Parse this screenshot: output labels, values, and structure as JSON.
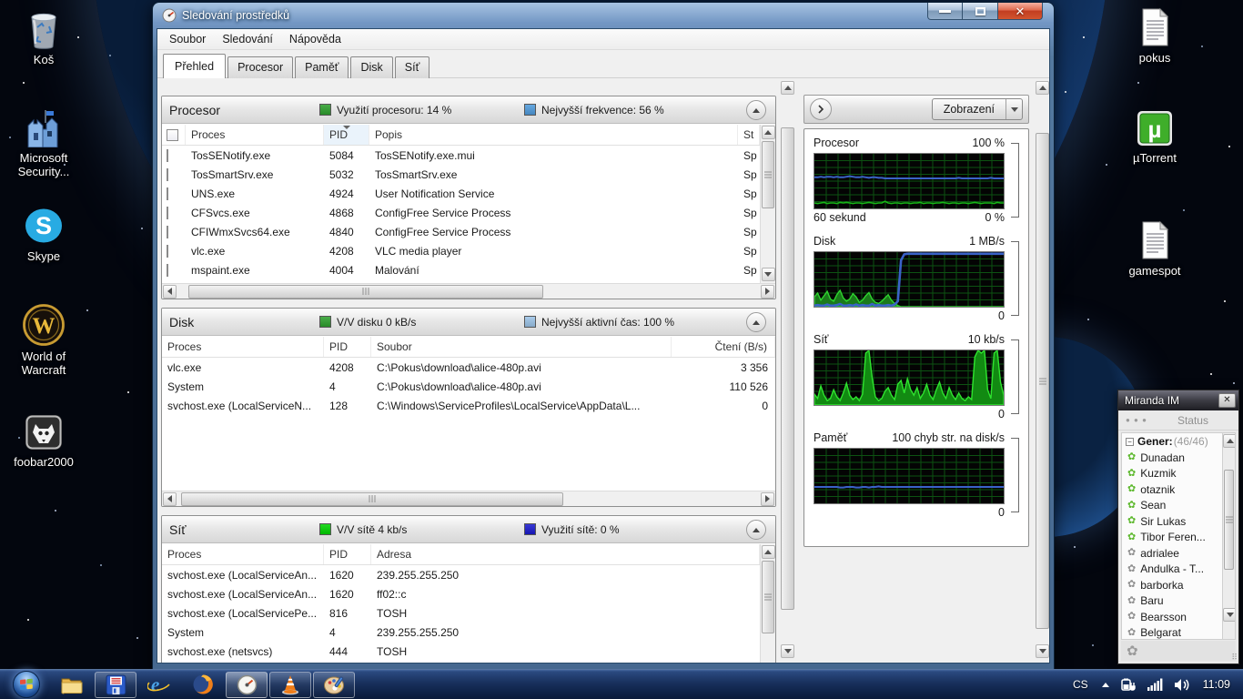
{
  "window": {
    "title": "Sledování prostředků",
    "menu": [
      "Soubor",
      "Sledování",
      "Nápověda"
    ],
    "tabs": [
      "Přehled",
      "Procesor",
      "Paměť",
      "Disk",
      "Síť"
    ],
    "active_tab": "Přehled"
  },
  "sections": [
    {
      "id": "cpu",
      "title": "Procesor",
      "legend1": {
        "label": "Využití procesoru: 14 %",
        "color": "#2da02d"
      },
      "legend2": {
        "label": "Nejvyšší frekvence: 56 %",
        "color": "#4f9bdc"
      },
      "checkbox": true,
      "columns": [
        "Proces",
        "PID",
        "Popis",
        "St"
      ],
      "sorted_column": "PID",
      "rows": [
        [
          "TosSENotify.exe",
          "5084",
          "TosSENotify.exe.mui",
          "Sp"
        ],
        [
          "TosSmartSrv.exe",
          "5032",
          "TosSmartSrv.exe",
          "Sp"
        ],
        [
          "UNS.exe",
          "4924",
          "User Notification Service",
          "Sp"
        ],
        [
          "CFSvcs.exe",
          "4868",
          "ConfigFree Service Process",
          "Sp"
        ],
        [
          "CFIWmxSvcs64.exe",
          "4840",
          "ConfigFree Service Process",
          "Sp"
        ],
        [
          "vlc.exe",
          "4208",
          "VLC media player",
          "Sp"
        ],
        [
          "mspaint.exe",
          "4004",
          "Malování",
          "Sp"
        ]
      ]
    },
    {
      "id": "disk",
      "title": "Disk",
      "legend1": {
        "label": "V/V disku 0 kB/s",
        "color": "#2da02d"
      },
      "legend2": {
        "label": "Nejvyšší aktivní čas: 100 %",
        "color": "#9cc4e8"
      },
      "checkbox": false,
      "columns": [
        "Proces",
        "PID",
        "Soubor",
        "Čtení (B/s)"
      ],
      "rows": [
        [
          "vlc.exe",
          "4208",
          "C:\\Pokus\\download\\alice-480p.avi",
          "3 356"
        ],
        [
          "System",
          "4",
          "C:\\Pokus\\download\\alice-480p.avi",
          "110 526"
        ],
        [
          "svchost.exe (LocalServiceN...",
          "128",
          "C:\\Windows\\ServiceProfiles\\LocalService\\AppData\\L...",
          "0"
        ]
      ]
    },
    {
      "id": "net",
      "title": "Síť",
      "legend1": {
        "label": "V/V sítě 4 kb/s",
        "color": "#00d400"
      },
      "legend2": {
        "label": "Využití sítě: 0 %",
        "color": "#1a1ace"
      },
      "checkbox": false,
      "columns": [
        "Proces",
        "PID",
        "Adresa"
      ],
      "rows": [
        [
          "svchost.exe (LocalServiceAn...",
          "1620",
          "239.255.255.250"
        ],
        [
          "svchost.exe (LocalServiceAn...",
          "1620",
          "ff02::c"
        ],
        [
          "svchost.exe (LocalServicePe...",
          "816",
          "TOSH"
        ],
        [
          "System",
          "4",
          "239.255.255.250"
        ],
        [
          "svchost.exe (netsvcs)",
          "444",
          "TOSH"
        ]
      ]
    }
  ],
  "right_panel": {
    "view_button": "Zobrazení"
  },
  "chart_data": [
    {
      "type": "line",
      "title": "Procesor",
      "max_label": "100 %",
      "min_label": "0 %",
      "x_label": "60 sekund",
      "ylim": [
        0,
        100
      ],
      "grid": true,
      "series": [
        {
          "name": "Nejvyšší frekvence",
          "color": "#3a62c8",
          "kind": "line",
          "width": 2,
          "values": [
            57,
            57,
            58,
            57,
            58,
            58,
            57,
            58,
            57,
            57,
            58,
            59,
            58,
            57,
            57,
            58,
            57,
            56,
            57,
            57,
            56,
            56,
            55,
            55,
            55,
            55,
            55,
            55,
            55,
            55,
            55,
            55,
            55,
            55,
            55,
            55,
            55,
            55,
            55,
            55,
            55,
            55,
            55,
            55,
            55,
            56,
            55,
            55,
            55,
            55,
            55,
            55,
            55,
            55,
            55,
            56,
            55,
            55,
            55,
            55
          ]
        },
        {
          "name": "Využití procesoru",
          "color": "#17b617",
          "kind": "line",
          "width": 1.6,
          "values": [
            10,
            9,
            10,
            11,
            9,
            10,
            10,
            9,
            11,
            10,
            11,
            10,
            9,
            10,
            10,
            9,
            10,
            11,
            10,
            9,
            10,
            10,
            13,
            10,
            9,
            10,
            10,
            9,
            10,
            10,
            9,
            10,
            10,
            11,
            9,
            10,
            10,
            9,
            10,
            10,
            11,
            10,
            9,
            10,
            10,
            9,
            10,
            10,
            9,
            10,
            11,
            10,
            9,
            10,
            10,
            10,
            9,
            11,
            10,
            10
          ]
        }
      ]
    },
    {
      "type": "area+line",
      "title": "Disk",
      "max_label": "1 MB/s",
      "min_label": "0",
      "ylim": [
        0,
        100
      ],
      "grid": true,
      "series": [
        {
          "name": "V/V disku",
          "color": "#2fd42f",
          "fill": "#1b7a1b",
          "kind": "area",
          "values": [
            18,
            25,
            12,
            20,
            28,
            14,
            10,
            22,
            30,
            16,
            10,
            14,
            24,
            18,
            8,
            12,
            20,
            26,
            14,
            8,
            6,
            10,
            16,
            22,
            12,
            6,
            2,
            0,
            0,
            0,
            0,
            0,
            0,
            0,
            0,
            0,
            0,
            0,
            0,
            0,
            0,
            0,
            0,
            0,
            0,
            0,
            0,
            0,
            0,
            0,
            0,
            0,
            0,
            0,
            0,
            0,
            0,
            0,
            0,
            0
          ]
        },
        {
          "name": "Nejvyšší aktivní čas",
          "color": "#3a62c8",
          "kind": "line",
          "width": 2.6,
          "values": [
            2,
            3,
            2,
            2,
            4,
            2,
            2,
            3,
            5,
            2,
            2,
            3,
            2,
            4,
            2,
            3,
            2,
            2,
            5,
            2,
            3,
            2,
            2,
            3,
            2,
            4,
            10,
            85,
            96,
            97,
            97,
            97,
            97,
            97,
            97,
            97,
            97,
            97,
            97,
            97,
            97,
            97,
            97,
            97,
            97,
            97,
            97,
            97,
            97,
            97,
            97,
            97,
            97,
            97,
            97,
            97,
            97,
            97,
            97,
            97
          ]
        }
      ]
    },
    {
      "type": "area",
      "title": "Síť",
      "max_label": "10 kb/s",
      "min_label": "0",
      "ylim": [
        0,
        100
      ],
      "grid": true,
      "series": [
        {
          "name": "V/V sítě",
          "color": "#2fe42f",
          "fill": "#128a12",
          "kind": "area",
          "values": [
            20,
            12,
            35,
            18,
            8,
            12,
            28,
            15,
            8,
            22,
            40,
            18,
            10,
            15,
            8,
            20,
            95,
            100,
            50,
            15,
            8,
            12,
            25,
            32,
            18,
            10,
            38,
            45,
            22,
            48,
            28,
            18,
            32,
            12,
            22,
            38,
            18,
            10,
            28,
            42,
            22,
            12,
            32,
            18,
            10,
            22,
            12,
            8,
            15,
            10,
            88,
            100,
            95,
            100,
            28,
            12,
            95,
            100,
            42,
            18
          ]
        }
      ]
    },
    {
      "type": "line",
      "title": "Paměť",
      "max_label": "100 chyb str. na disk/s",
      "min_label": "0",
      "ylim": [
        0,
        100
      ],
      "grid": true,
      "series": [
        {
          "name": "Chyby stránkování",
          "color": "#3a62c8",
          "kind": "line",
          "width": 2,
          "values": [
            30,
            30,
            30,
            30,
            30,
            30,
            30,
            30,
            29,
            29,
            30,
            30,
            30,
            29,
            29,
            30,
            30,
            29,
            30,
            30,
            31,
            30,
            30,
            30,
            30,
            30,
            30,
            30,
            30,
            30,
            30,
            30,
            30,
            30,
            30,
            30,
            30,
            30,
            30,
            30,
            30,
            30,
            30,
            30,
            30,
            30,
            30,
            30,
            30,
            30,
            30,
            30,
            30,
            30,
            30,
            30,
            30,
            30,
            30,
            30
          ]
        }
      ]
    }
  ],
  "desktop": {
    "icons": [
      {
        "label": "Koš",
        "icon": "recycle-bin"
      },
      {
        "label": "Microsoft\nSecurity...",
        "icon": "security"
      },
      {
        "label": "Skype",
        "icon": "skype"
      },
      {
        "label": "World of\nWarcraft",
        "icon": "wow"
      },
      {
        "label": "foobar2000",
        "icon": "foobar"
      },
      {
        "label": "pokus",
        "icon": "document"
      },
      {
        "label": "µTorrent",
        "icon": "utorrent"
      },
      {
        "label": "gamespot",
        "icon": "document"
      }
    ]
  },
  "miranda": {
    "title": "Miranda IM",
    "status_header": "Status",
    "group": {
      "label": "Gener:",
      "count": "(46/46)"
    },
    "contacts": [
      {
        "name": "Dunadan",
        "status": "online"
      },
      {
        "name": "Kuzmik",
        "status": "online"
      },
      {
        "name": "otaznik",
        "status": "online"
      },
      {
        "name": "Sean",
        "status": "online"
      },
      {
        "name": "Sir Lukas",
        "status": "online"
      },
      {
        "name": "Tibor Feren...",
        "status": "online"
      },
      {
        "name": "adrialee",
        "status": "offline"
      },
      {
        "name": "Andulka - T...",
        "status": "offline"
      },
      {
        "name": "barborka",
        "status": "offline"
      },
      {
        "name": "Baru",
        "status": "offline"
      },
      {
        "name": "Bearsson",
        "status": "offline"
      },
      {
        "name": "Belgarat",
        "status": "offline"
      }
    ],
    "status_colors": {
      "online": "#5cb82c",
      "offline": "#8f8f8f"
    }
  },
  "taskbar": {
    "language": "CS",
    "time": "11:09",
    "items": [
      {
        "icon": "explorer",
        "running": false,
        "active": false
      },
      {
        "icon": "floppy",
        "running": true,
        "active": false
      },
      {
        "icon": "ie",
        "running": false,
        "active": false
      },
      {
        "icon": "firefox",
        "running": false,
        "active": false
      },
      {
        "icon": "resmon",
        "running": true,
        "active": true
      },
      {
        "icon": "vlc",
        "running": true,
        "active": false
      },
      {
        "icon": "paint",
        "running": true,
        "active": false
      }
    ]
  }
}
